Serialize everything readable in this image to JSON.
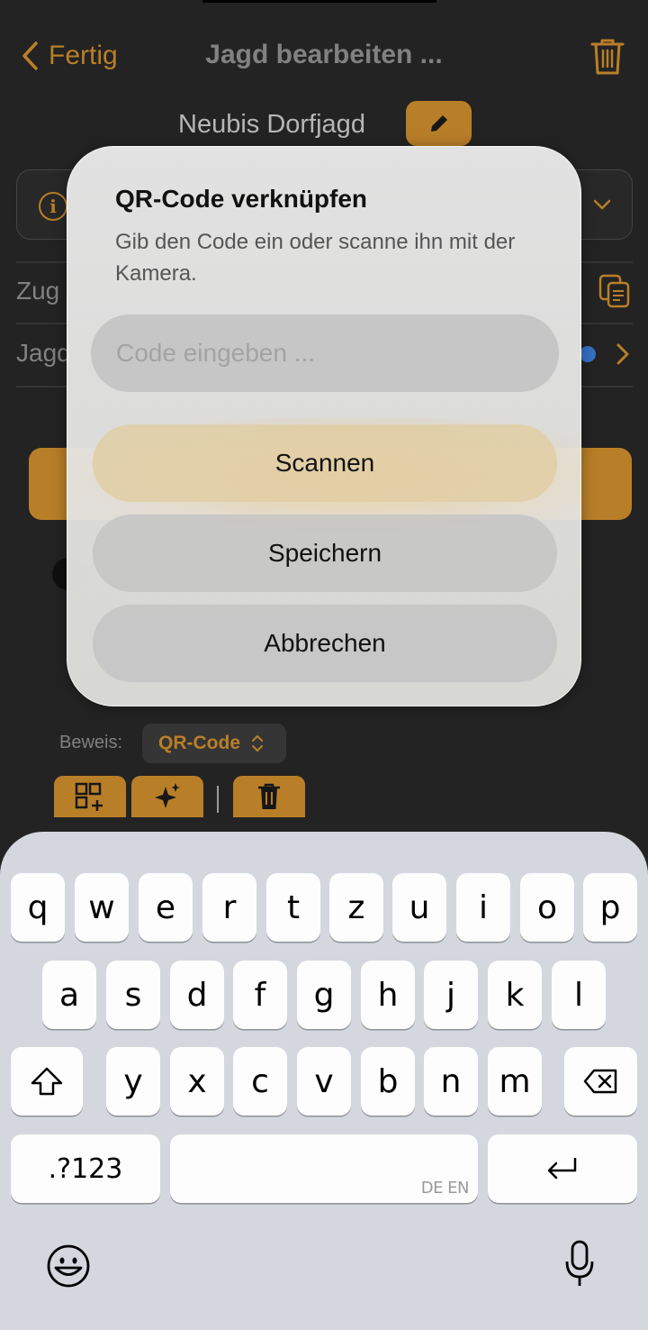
{
  "nav": {
    "back_label": "Fertig",
    "title": "Jagd bearbeiten ..."
  },
  "hunt": {
    "name": "Neubis Dorfjagd"
  },
  "rows": {
    "row1_label": "Zug",
    "row2_label": "Jagd"
  },
  "evidence": {
    "label": "Beweis:",
    "value": "QR-Code"
  },
  "dialog": {
    "title": "QR-Code verknüpfen",
    "message": "Gib den Code ein oder scanne ihn mit der Kamera.",
    "input_placeholder": "Code eingeben ...",
    "scan_label": "Scannen",
    "save_label": "Speichern",
    "cancel_label": "Abbrechen"
  },
  "keyboard": {
    "row1": [
      "q",
      "w",
      "e",
      "r",
      "t",
      "z",
      "u",
      "i",
      "o",
      "p"
    ],
    "row2": [
      "a",
      "s",
      "d",
      "f",
      "g",
      "h",
      "j",
      "k",
      "l"
    ],
    "row3": [
      "y",
      "x",
      "c",
      "v",
      "b",
      "n",
      "m"
    ],
    "numbers_label": ".?123",
    "space_hint": "DE EN"
  },
  "colors": {
    "accent": "#c98a2c",
    "background": "#262626",
    "keyboard": "#d4d7de"
  }
}
